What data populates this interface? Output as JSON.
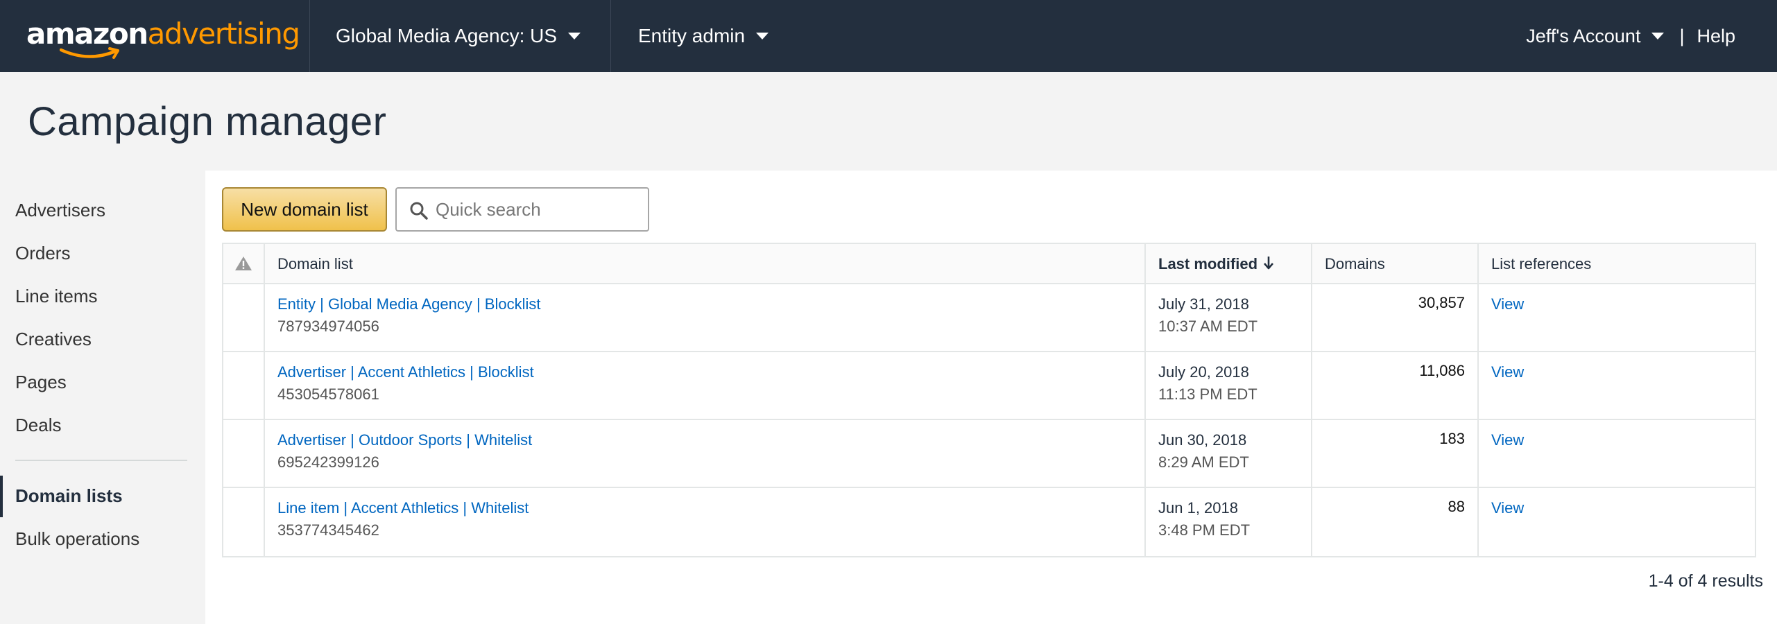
{
  "brand": {
    "word1": "amazon",
    "word2": "advertising"
  },
  "topnav": {
    "agency": "Global Media Agency: US",
    "entity": "Entity admin",
    "account": "Jeff's Account",
    "separator": "|",
    "help": "Help"
  },
  "page": {
    "title": "Campaign manager"
  },
  "sidebar": {
    "items": [
      {
        "label": "Advertisers"
      },
      {
        "label": "Orders"
      },
      {
        "label": "Line items"
      },
      {
        "label": "Creatives"
      },
      {
        "label": "Pages"
      },
      {
        "label": "Deals"
      }
    ],
    "items2": [
      {
        "label": "Domain lists",
        "active": true
      },
      {
        "label": "Bulk operations"
      }
    ]
  },
  "toolbar": {
    "new_button": "New domain list",
    "search_placeholder": "Quick search"
  },
  "table": {
    "headers": {
      "name": "Domain list",
      "modified": "Last modified",
      "domains": "Domains",
      "refs": "List references"
    },
    "rows": [
      {
        "name": "Entity | Global Media Agency | Blocklist",
        "id": "787934974056",
        "date": "July 31, 2018",
        "time": "10:37 AM EDT",
        "domains": "30,857",
        "ref": "View"
      },
      {
        "name": "Advertiser | Accent Athletics | Blocklist",
        "id": "453054578061",
        "date": "July 20, 2018",
        "time": "11:13 PM EDT",
        "domains": "11,086",
        "ref": "View"
      },
      {
        "name": "Advertiser | Outdoor Sports | Whitelist",
        "id": "695242399126",
        "date": "Jun 30, 2018",
        "time": "8:29 AM EDT",
        "domains": "183",
        "ref": "View"
      },
      {
        "name": "Line item | Accent Athletics | Whitelist",
        "id": "353774345462",
        "date": "Jun 1, 2018",
        "time": "3:48 PM EDT",
        "domains": "88",
        "ref": "View"
      }
    ]
  },
  "pagination": {
    "summary": "1-4 of 4 results"
  },
  "colors": {
    "nav_bg": "#232f3e",
    "brand_orange": "#ff9900",
    "link": "#0066c0",
    "button_yellow": "#f0c14b"
  }
}
